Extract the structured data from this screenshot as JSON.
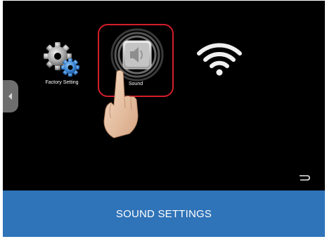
{
  "screen": {
    "apps": [
      {
        "label": "Factory Setting",
        "icon": "gear-icon"
      },
      {
        "label": "Sound",
        "icon": "speaker-icon",
        "selected": true
      },
      {
        "label": "",
        "icon": "wifi-icon"
      }
    ],
    "side_tab_icon": "chevron-left-icon",
    "return_icon": "return-icon",
    "pointer_icon": "hand-pointer-icon"
  },
  "caption": {
    "text": "SOUND SETTINGS"
  },
  "colors": {
    "screen_bg": "#000000",
    "highlight": "#d21e2a",
    "caption_bg": "#2f73b8"
  }
}
